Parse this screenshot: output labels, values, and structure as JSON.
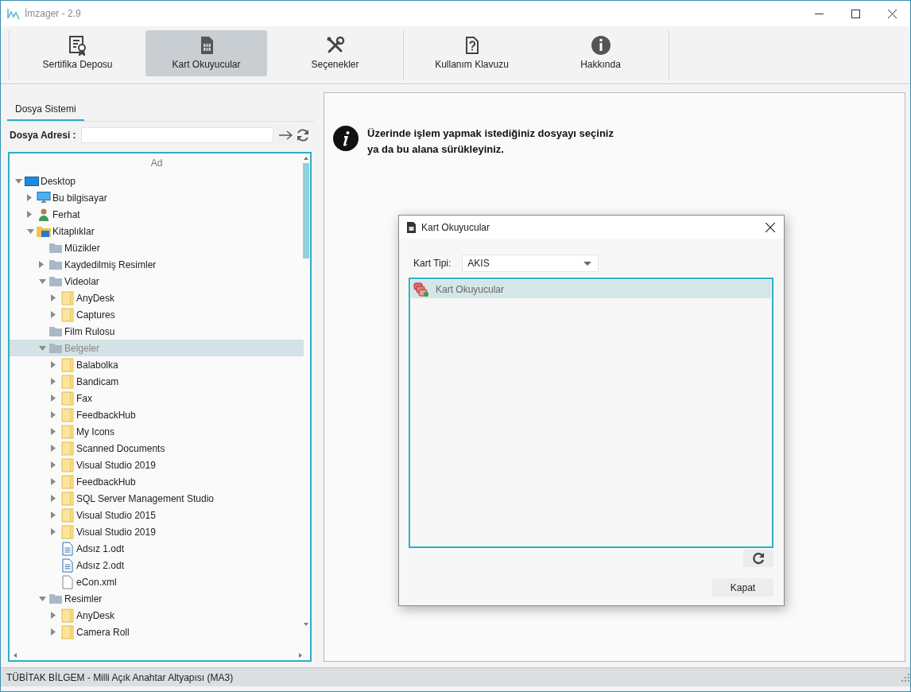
{
  "window": {
    "title": "İmzager - 2.9"
  },
  "toolbar": [
    {
      "label": "Sertifika Deposu",
      "kind": "certificate",
      "selected": false
    },
    {
      "label": "Kart Okuyucular",
      "kind": "sim-card",
      "selected": true
    },
    {
      "label": "Seçenekler",
      "kind": "tools",
      "selected": false
    },
    {
      "label": "Kullanım Klavuzu",
      "kind": "help-document",
      "selected": false
    },
    {
      "label": "Hakkında",
      "kind": "info",
      "selected": false
    }
  ],
  "file_panel": {
    "tab": {
      "label": "Dosya Sistemi",
      "selected": true
    },
    "address_label": "Dosya Adresi :",
    "column_header": "Ad",
    "tree": [
      {
        "label": "Desktop",
        "kind": "desktop",
        "expanded": true,
        "selected": false,
        "children": [
          {
            "label": "Bu bilgisayar",
            "kind": "computer",
            "expanded": false,
            "selected": false
          },
          {
            "label": "Ferhat",
            "kind": "user",
            "expanded": false,
            "selected": false
          },
          {
            "label": "Kitaplıklar",
            "kind": "library",
            "expanded": true,
            "selected": false,
            "children": [
              {
                "label": "Müzikler",
                "kind": "system-folder",
                "selected": false
              },
              {
                "label": "Kaydedilmiş Resimler",
                "kind": "system-folder",
                "expanded": false,
                "selected": false
              },
              {
                "label": "Videolar",
                "kind": "system-folder",
                "expanded": true,
                "selected": false,
                "children": [
                  {
                    "label": "AnyDesk",
                    "kind": "folder",
                    "expanded": false,
                    "selected": false
                  },
                  {
                    "label": "Captures",
                    "kind": "folder",
                    "expanded": false,
                    "selected": false
                  }
                ]
              },
              {
                "label": "Film Rulosu",
                "kind": "system-folder",
                "selected": false
              },
              {
                "label": "Belgeler",
                "kind": "system-folder",
                "expanded": true,
                "selected": true,
                "children": [
                  {
                    "label": "Balabolka",
                    "kind": "folder",
                    "expanded": false,
                    "selected": false
                  },
                  {
                    "label": "Bandicam",
                    "kind": "folder",
                    "expanded": false,
                    "selected": false
                  },
                  {
                    "label": "Fax",
                    "kind": "folder",
                    "expanded": false,
                    "selected": false
                  },
                  {
                    "label": "FeedbackHub",
                    "kind": "folder",
                    "expanded": false,
                    "selected": false
                  },
                  {
                    "label": "My Icons",
                    "kind": "folder",
                    "expanded": false,
                    "selected": false
                  },
                  {
                    "label": "Scanned Documents",
                    "kind": "folder",
                    "expanded": false,
                    "selected": false
                  },
                  {
                    "label": "Visual Studio 2019",
                    "kind": "folder",
                    "expanded": false,
                    "selected": false
                  },
                  {
                    "label": "FeedbackHub",
                    "kind": "folder",
                    "expanded": false,
                    "selected": false
                  },
                  {
                    "label": "SQL Server Management Studio",
                    "kind": "folder",
                    "expanded": false,
                    "selected": false
                  },
                  {
                    "label": "Visual Studio 2015",
                    "kind": "folder",
                    "expanded": false,
                    "selected": false
                  },
                  {
                    "label": "Visual Studio 2019",
                    "kind": "folder",
                    "expanded": false,
                    "selected": false
                  },
                  {
                    "label": "Adsız 1.odt",
                    "kind": "document",
                    "selected": false
                  },
                  {
                    "label": "Adsız 2.odt",
                    "kind": "document",
                    "selected": false
                  },
                  {
                    "label": "eCon.xml",
                    "kind": "file",
                    "selected": false
                  }
                ]
              },
              {
                "label": "Resimler",
                "kind": "system-folder",
                "expanded": true,
                "selected": false,
                "children": [
                  {
                    "label": "AnyDesk",
                    "kind": "folder",
                    "expanded": false,
                    "selected": false
                  },
                  {
                    "label": "Camera Roll",
                    "kind": "folder",
                    "expanded": false,
                    "selected": false
                  }
                ]
              }
            ]
          }
        ]
      }
    ]
  },
  "drop_area": {
    "message": "Üzerinde işlem yapmak istediğiniz dosyayı seçiniz\nya da bu alana sürükleyiniz."
  },
  "dialog": {
    "title": "Kart Okuyucular",
    "card_type_label": "Kart Tipi:",
    "card_type_value": "AKIS",
    "readers": [
      {
        "label": "Kart Okuyucular",
        "selected": true
      }
    ],
    "close_button": "Kapat"
  },
  "status_bar": {
    "text": "TÜBİTAK BİLGEM - Milli Açık Anahtar Altyapısı (MA3)"
  }
}
